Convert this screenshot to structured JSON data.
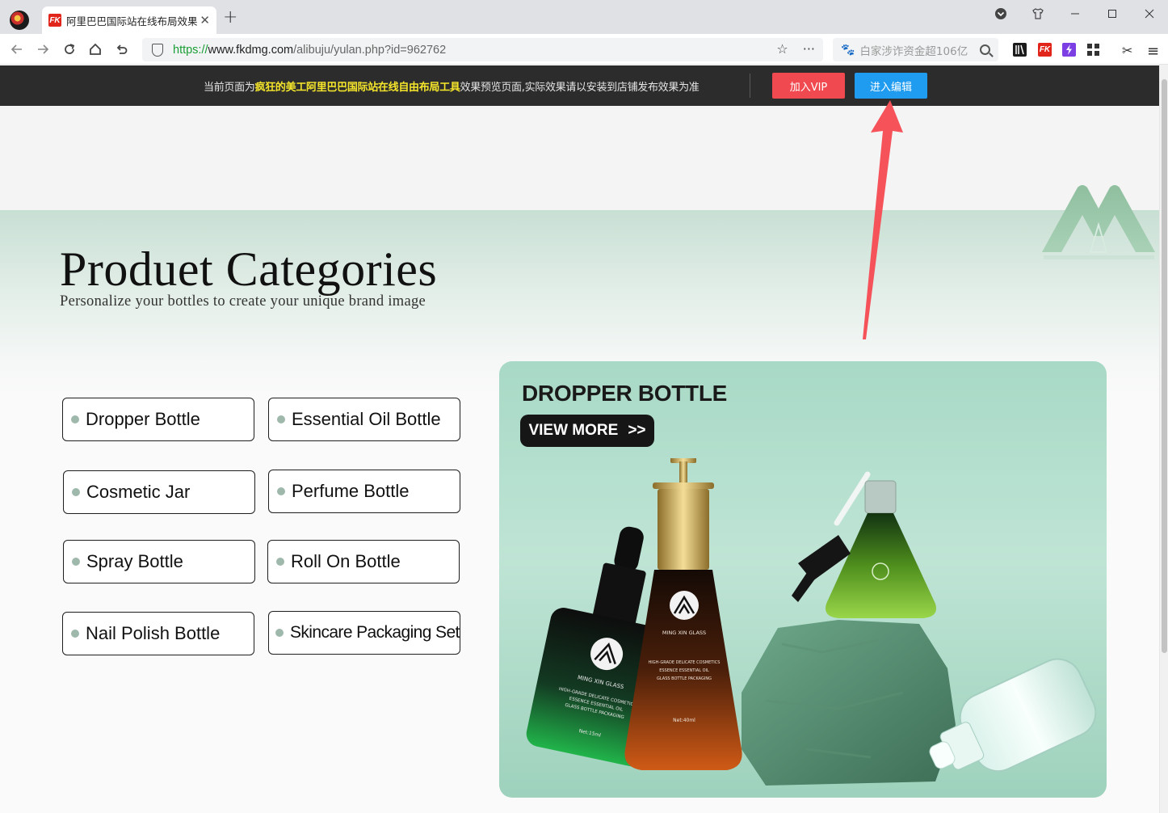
{
  "browser": {
    "tab_title": "阿里巴巴国际站在线布局效果",
    "tab_favicon_text": "FK",
    "url_scheme": "https://",
    "url_domain": "www.fkdmg.com",
    "url_path": "/alibuju/yulan.php?id=962762",
    "search_placeholder": "白家涉诈资金超106亿",
    "new_tab": "+",
    "close_tab": "✕",
    "window_buttons": [
      "⊖",
      "⬚",
      "—",
      "☐",
      "✕"
    ],
    "more_dots": "···",
    "star": "☆",
    "menu": "≡",
    "scissors": "✂",
    "accent_green": "#1a9e35"
  },
  "notice": {
    "prefix": "当前页面为",
    "highlight": "疯狂的美工阿里巴巴国际站在线自由布局工具",
    "suffix": "效果预览页面,实际效果请以安装到店铺发布效果为准",
    "vip_button": "加入VIP",
    "edit_button": "进入编辑",
    "vip_color": "#f0494f",
    "edit_color": "#1f9cf0"
  },
  "page": {
    "title": "Produet Categories",
    "subtitle": "Personalize your bottles to create your unique brand image",
    "categories": [
      "Dropper Bottle",
      "Essential Oil Bottle",
      "Cosmetic Jar",
      "Perfume Bottle",
      "Spray Bottle",
      "Roll On Bottle",
      "Nail Polish Bottle",
      "Skincare Packaging Set"
    ],
    "feature": {
      "title": "DROPPER BOTTLE",
      "button_label": "VIEW MORE",
      "button_arrows": ">>",
      "bottle_brand": "MING XIN GLASS",
      "bottle_copy": [
        "HIGH-GRADE DELICATE COSMETICS",
        "ESSENCE ESSENTIAL OIL",
        "GLASS BOTTLE PACKAGING"
      ],
      "net_15": "Net:15ml",
      "net_40": "Net:40ml"
    }
  }
}
